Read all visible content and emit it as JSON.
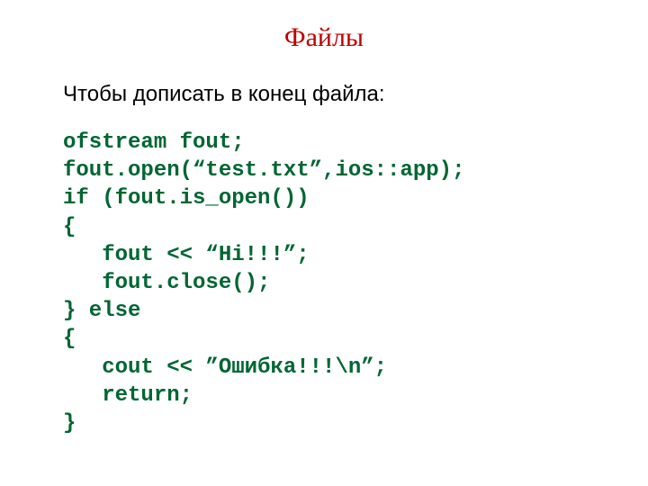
{
  "title": "Файлы",
  "intro": "Чтобы дописать в  конец файла:",
  "code": {
    "l0": "ofstream fout;",
    "l1": "fout.open(“test.txt”,ios::app);",
    "l2": "if (fout.is_open())",
    "l3": "{",
    "l4": "   fout << “Hi!!!”;",
    "l5": "   fout.close();",
    "l6": "} else",
    "l7": "{",
    "l8": "   cout << ”Ошибка!!!\\n”;",
    "l9": "   return;",
    "l10": "}"
  }
}
